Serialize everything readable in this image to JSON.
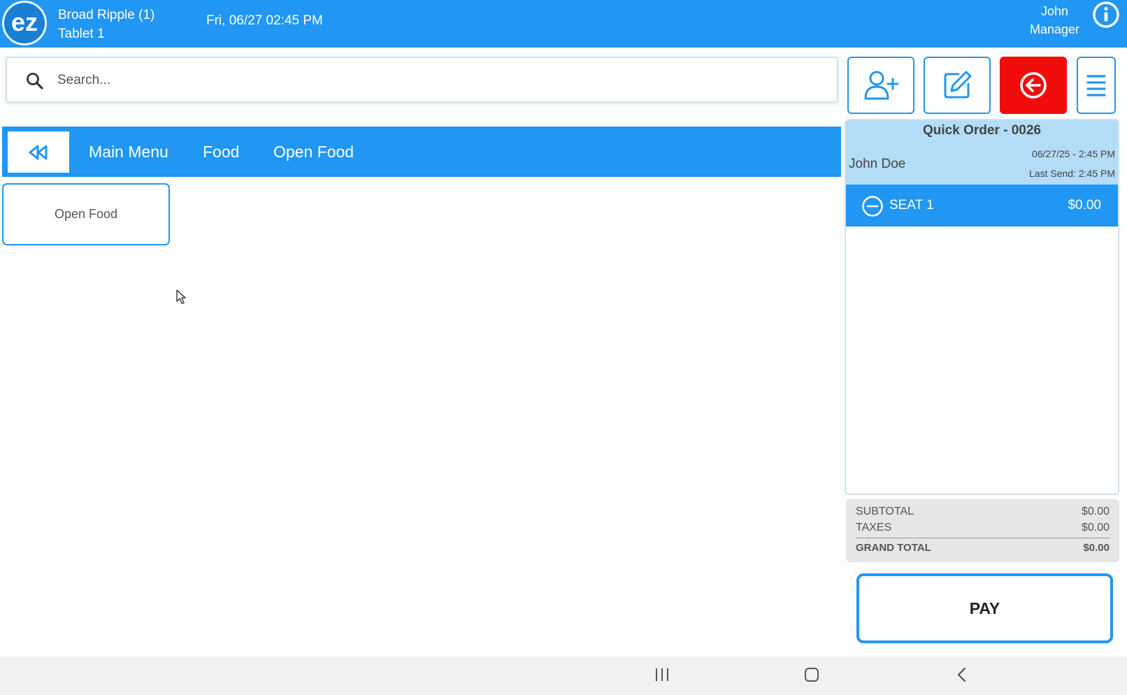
{
  "header": {
    "logo_text": "ez",
    "store_name": "Broad Ripple (1)",
    "device_name": "Tablet 1",
    "datetime": "Fri, 06/27 02:45 PM",
    "user_name": "John",
    "user_role": "Manager"
  },
  "search": {
    "placeholder": "Search..."
  },
  "breadcrumb": {
    "items": [
      "Main Menu",
      "Food",
      "Open Food"
    ]
  },
  "items": [
    {
      "label": "Open Food"
    }
  ],
  "order": {
    "title": "Quick Order - 0026",
    "customer": "John Doe",
    "date": "06/27/25  - 2:45 PM",
    "last_send": "Last Send: 2:45 PM",
    "seats": [
      {
        "label": "SEAT 1",
        "amount": "$0.00"
      }
    ]
  },
  "totals": {
    "subtotal_label": "SUBTOTAL",
    "subtotal": "$0.00",
    "taxes_label": "TAXES",
    "taxes": "$0.00",
    "grand_total_label": "GRAND TOTAL",
    "grand_total": "$0.00"
  },
  "pay_label": "PAY",
  "colors": {
    "primary": "#2196f3",
    "danger": "#f20d0d",
    "panel_header": "#b3dcf7"
  }
}
